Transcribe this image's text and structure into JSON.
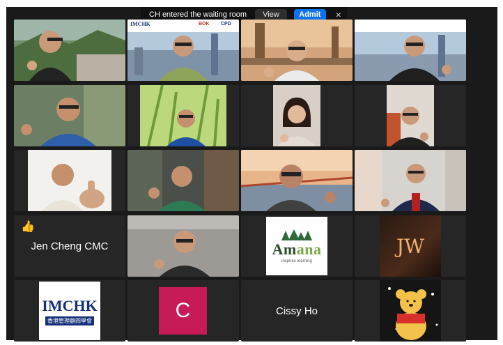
{
  "notification": {
    "message": "CH entered the waiting room",
    "view_label": "View",
    "admit_label": "Admit",
    "close_glyph": "×"
  },
  "participants": {
    "jen_cheng": {
      "name": "Jen Cheng CMC",
      "reaction": "👍"
    },
    "c_avatar": {
      "initial": "C"
    },
    "cissy_ho": {
      "name": "Cissy Ho"
    }
  },
  "logos": {
    "amana": {
      "word_a": "Am",
      "word_b": "ana",
      "tagline": "inspires learning"
    },
    "imchk": {
      "word": "IMCHK",
      "subtitle": "香港管理顧問學會"
    },
    "jw": {
      "text": "JW"
    },
    "bg_banner": {
      "imchk": "IMCHK",
      "bok": "BOK",
      "cpd": "CPD"
    }
  },
  "colors": {
    "admit_button": "#0e72ed",
    "active_speaker": "#23d959",
    "avatar_c": "#c71b58"
  }
}
